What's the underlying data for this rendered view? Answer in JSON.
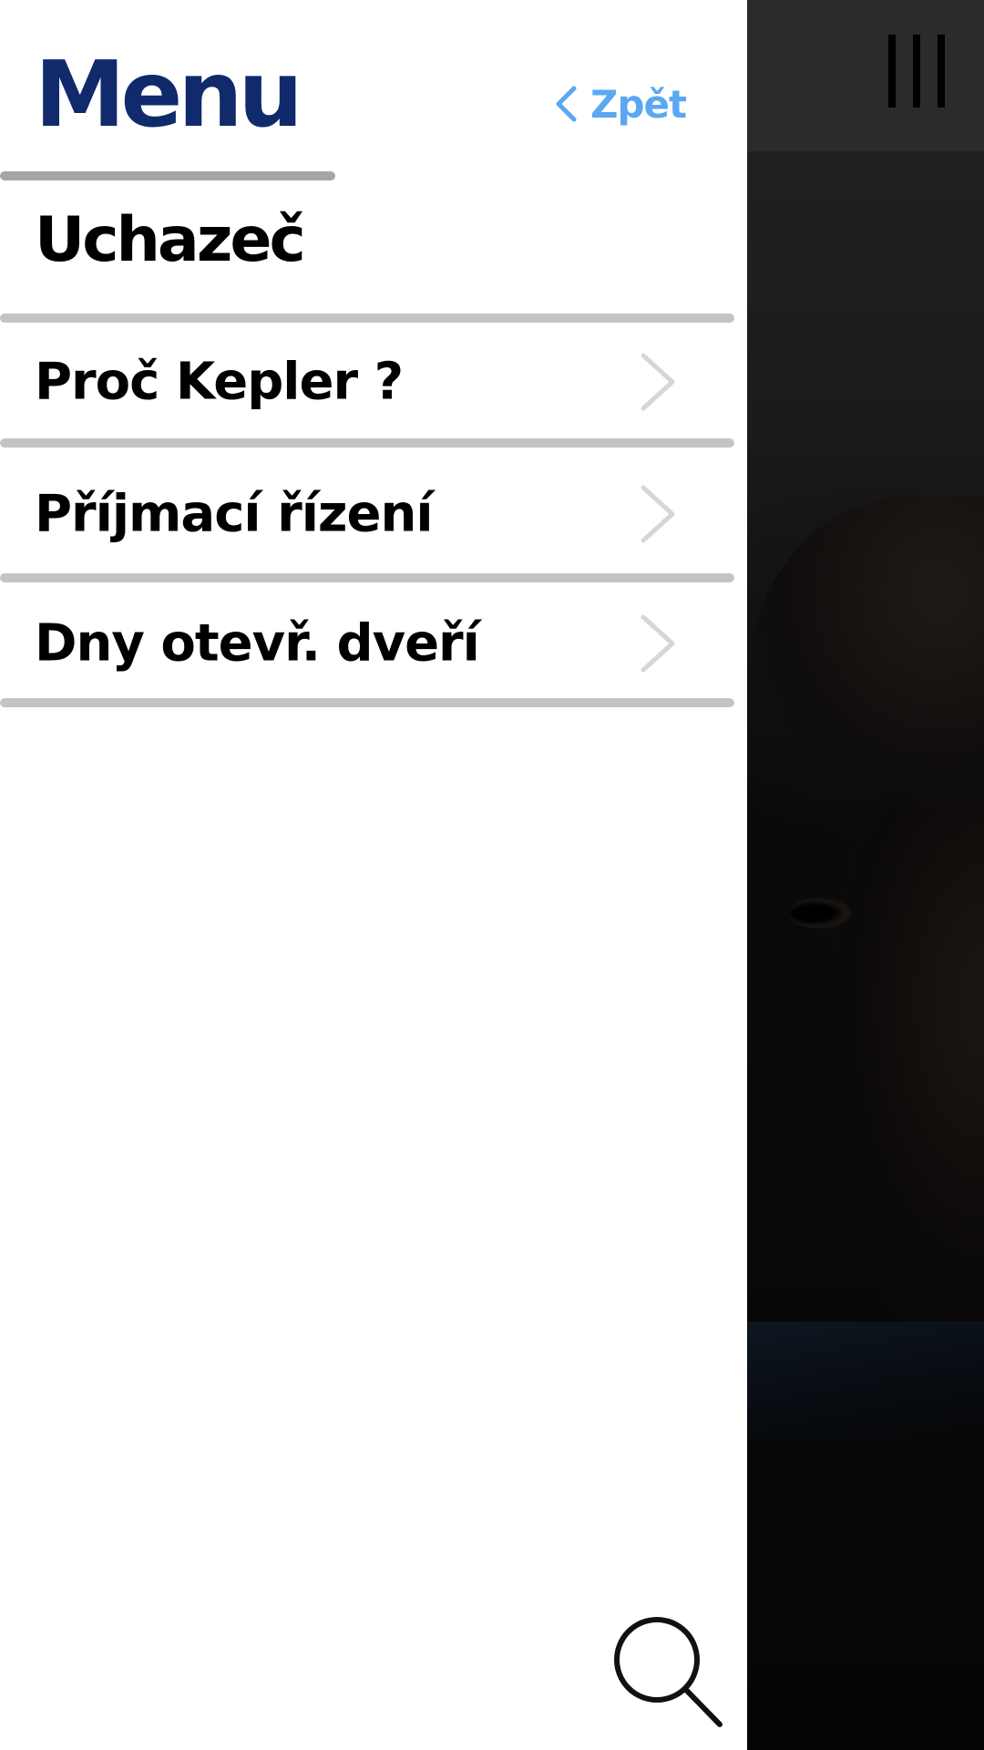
{
  "drawer": {
    "title": "Menu",
    "back_label": "Zpět",
    "section_heading": "Uchazeč",
    "items": [
      {
        "label": "Proč Kepler ?",
        "icon": "chevron-right-icon"
      },
      {
        "label": "Příjmací řízení",
        "icon": "chevron-right-icon"
      },
      {
        "label": "Dny otevř. dveří",
        "icon": "chevron-right-icon"
      }
    ],
    "search_icon": "search-icon"
  },
  "header": {
    "menu_icon": "hamburger-icon"
  },
  "colors": {
    "title": "#102a6b",
    "back_link": "#5aa8f2",
    "divider": "#c4c4c4",
    "chevron": "#d6d6d6",
    "overlay": "#2b2b2b"
  }
}
